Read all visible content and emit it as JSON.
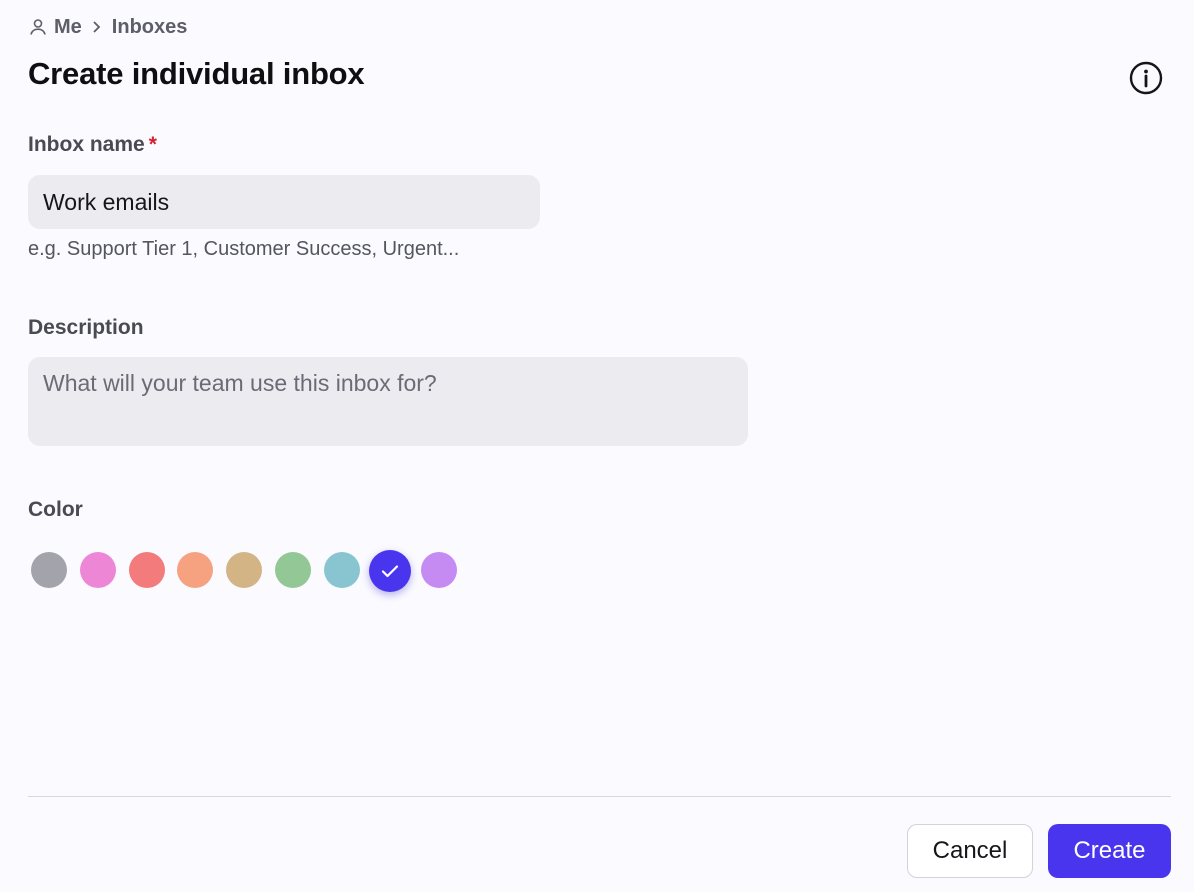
{
  "breadcrumb": {
    "icon": "user-icon",
    "items": [
      "Me",
      "Inboxes"
    ],
    "separator_icon": "chevron-right-icon"
  },
  "title": "Create individual inbox",
  "info_icon": "info-circle-icon",
  "form": {
    "inbox_name": {
      "label": "Inbox name",
      "required_mark": "*",
      "value": "Work emails",
      "hint": "e.g. Support Tier 1, Customer Success, Urgent..."
    },
    "description": {
      "label": "Description",
      "value": "",
      "placeholder": "What will your team use this inbox for?"
    },
    "color": {
      "label": "Color",
      "options": [
        {
          "name": "gray",
          "hex": "#a3a3ab"
        },
        {
          "name": "pink",
          "hex": "#ee86d6"
        },
        {
          "name": "red",
          "hex": "#f37b7b"
        },
        {
          "name": "orange",
          "hex": "#f6a280"
        },
        {
          "name": "tan",
          "hex": "#d3b485"
        },
        {
          "name": "green",
          "hex": "#93c896"
        },
        {
          "name": "teal",
          "hex": "#89c5d0"
        },
        {
          "name": "indigo",
          "hex": "#4a35ee"
        },
        {
          "name": "violet",
          "hex": "#c68af3"
        }
      ],
      "selected": "indigo",
      "selected_icon": "checkmark-icon"
    }
  },
  "actions": {
    "cancel_label": "Cancel",
    "create_label": "Create"
  },
  "colors": {
    "accent": "#4a35ee",
    "required": "#d4202f",
    "background": "#fafaff",
    "input_background": "#ebebf0"
  }
}
